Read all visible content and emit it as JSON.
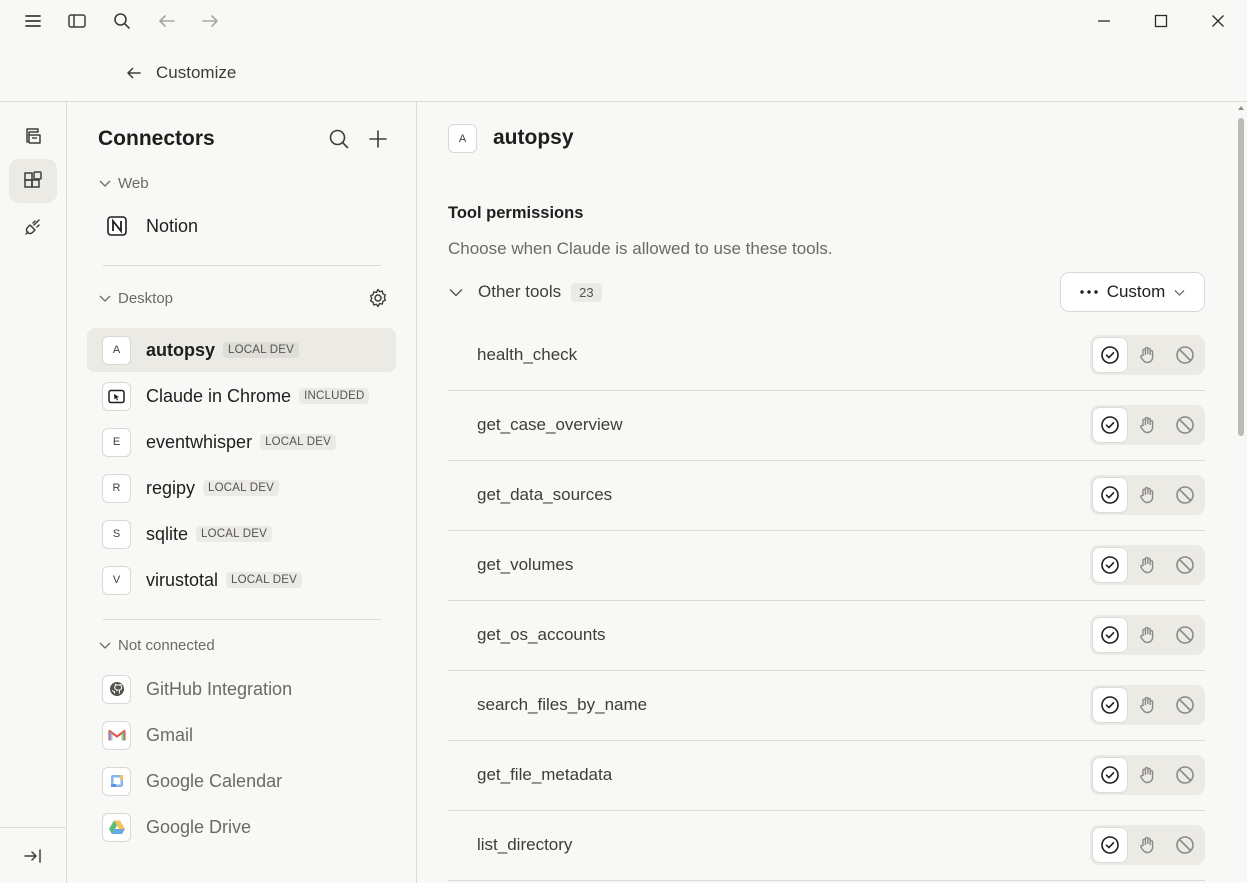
{
  "header": {
    "back_label": "Customize"
  },
  "panel": {
    "title": "Connectors",
    "groups": {
      "web": "Web",
      "desktop": "Desktop",
      "not_connected": "Not connected"
    },
    "web_items": [
      {
        "name": "Notion",
        "icon": "notion-logo"
      }
    ],
    "desktop_items": [
      {
        "avatar": "A",
        "name": "autopsy",
        "badge": "LOCAL DEV",
        "active": true
      },
      {
        "avatar": "",
        "name": "Claude in Chrome",
        "badge": "INCLUDED",
        "icon": "chrome-cursor-icon"
      },
      {
        "avatar": "E",
        "name": "eventwhisper",
        "badge": "LOCAL DEV"
      },
      {
        "avatar": "R",
        "name": "regipy",
        "badge": "LOCAL DEV"
      },
      {
        "avatar": "S",
        "name": "sqlite",
        "badge": "LOCAL DEV"
      },
      {
        "avatar": "V",
        "name": "virustotal",
        "badge": "LOCAL DEV"
      }
    ],
    "not_connected_items": [
      {
        "name": "GitHub Integration",
        "icon": "github-icon"
      },
      {
        "name": "Gmail",
        "icon": "gmail-icon"
      },
      {
        "name": "Google Calendar",
        "icon": "google-calendar-icon"
      },
      {
        "name": "Google Drive",
        "icon": "google-drive-icon"
      }
    ]
  },
  "main": {
    "avatar": "A",
    "title": "autopsy",
    "permissions_title": "Tool permissions",
    "permissions_desc": "Choose when Claude is allowed to use these tools.",
    "other_tools_label": "Other tools",
    "other_tools_count": "23",
    "custom_label": "Custom",
    "tools": [
      "health_check",
      "get_case_overview",
      "get_data_sources",
      "get_volumes",
      "get_os_accounts",
      "search_files_by_name",
      "get_file_metadata",
      "list_directory"
    ],
    "selected_permission": "allow"
  }
}
